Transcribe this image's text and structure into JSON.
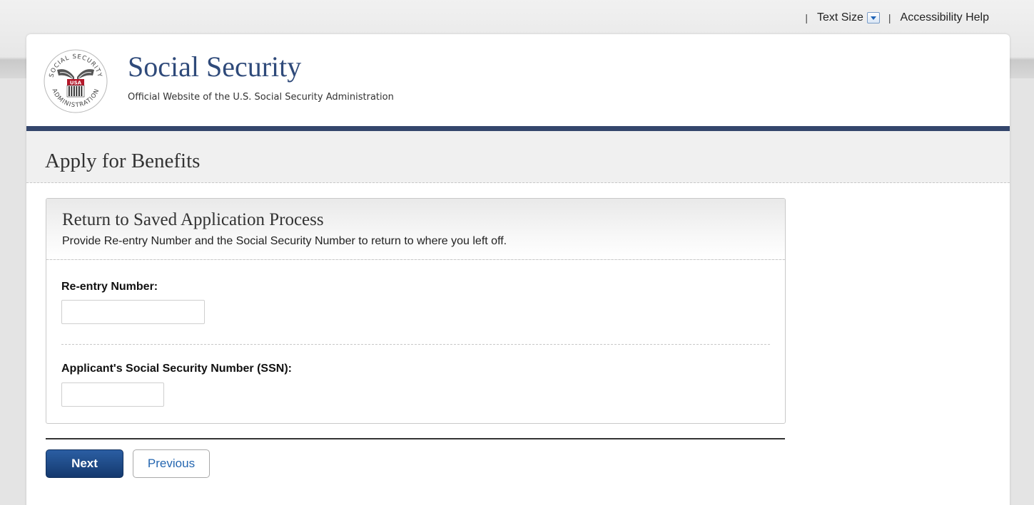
{
  "utility_bar": {
    "separator": "|",
    "text_size_label": "Text Size",
    "accessibility_help_label": "Accessibility Help"
  },
  "header": {
    "seal_lettering": "SOCIAL SECURITY ADMINISTRATION USA",
    "title": "Social Security",
    "subtitle": "Official Website of the U.S. Social Security Administration"
  },
  "page": {
    "title": "Apply for Benefits"
  },
  "panel": {
    "title": "Return to Saved Application Process",
    "subtitle": "Provide Re-entry Number and the Social Security Number to return to where you left off.",
    "fields": [
      {
        "label": "Re-entry Number:",
        "value": "",
        "placeholder": ""
      },
      {
        "label": "Applicant's Social Security Number (SSN):",
        "value": "",
        "placeholder": ""
      }
    ]
  },
  "buttons": {
    "next_label": "Next",
    "previous_label": "Previous"
  },
  "colors": {
    "brand_navy": "#34466c",
    "title_blue": "#2f4a7a",
    "next_button": "#1f4a86",
    "link_blue": "#2466b0"
  },
  "icons": {
    "text_size": "chevron-down-icon",
    "seal": "ssa-seal-logo"
  }
}
